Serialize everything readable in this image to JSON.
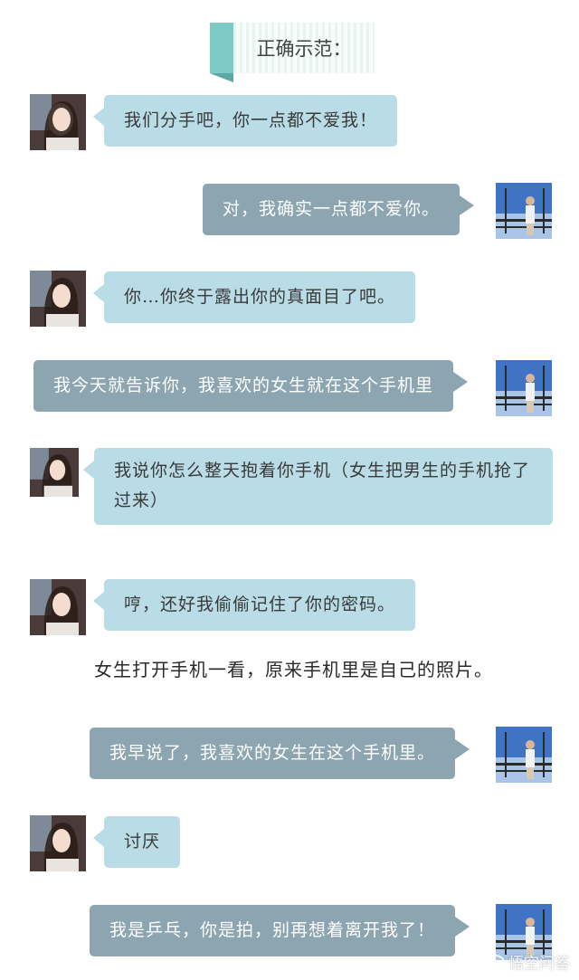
{
  "header": {
    "title": "正确示范："
  },
  "messages": [
    {
      "sender": "her",
      "text": "我们分手吧，你一点都不爱我！"
    },
    {
      "sender": "him",
      "text": "对，我确实一点都不爱你。"
    },
    {
      "sender": "her",
      "text": "你…你终于露出你的真面目了吧。"
    },
    {
      "sender": "him",
      "text": "我今天就告诉你，我喜欢的女生就在这个手机里"
    },
    {
      "sender": "her",
      "text": "我说你怎么整天抱着你手机（女生把男生的手机抢了过来）"
    },
    {
      "sender": "her",
      "text": "哼，还好我偷偷记住了你的密码。"
    },
    {
      "sender": "him",
      "text": "我早说了，我喜欢的女生在这个手机里。"
    },
    {
      "sender": "her",
      "text": "讨厌"
    },
    {
      "sender": "him",
      "text": "我是乒乓，你是拍，别再想着离开我了！"
    }
  ],
  "narration": "女生打开手机一看，原来手机里是自己的照片。",
  "watermark": {
    "text": "悟空问答"
  },
  "colors": {
    "her_bubble": "#b9dce6",
    "him_bubble": "#8ca5b1",
    "banner_accent": "#7ecac6"
  }
}
